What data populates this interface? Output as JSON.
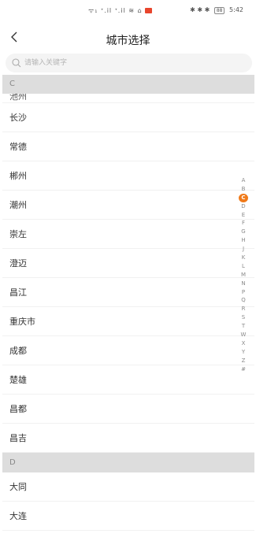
{
  "status_bar": {
    "signal_text": "ᯤ₁ ᐩ.il ᐩ.il ≋ ⌂",
    "right_icons": "✱ ✱ ✱",
    "battery": "88",
    "time": "5:42"
  },
  "nav": {
    "title": "城市选择"
  },
  "search": {
    "placeholder": "请输入关键字",
    "value": ""
  },
  "sections": [
    {
      "letter": "C",
      "partial_city": "池州",
      "cities": [
        "长沙",
        "常德",
        "郴州",
        "潮州",
        "崇左",
        "澄迈",
        "昌江",
        "重庆市",
        "成都",
        "楚雄",
        "昌都",
        "昌吉"
      ]
    },
    {
      "letter": "D",
      "cities": [
        "大同",
        "大连"
      ]
    }
  ],
  "index": {
    "letters": [
      "A",
      "B",
      "C",
      "D",
      "E",
      "F",
      "G",
      "H",
      "J",
      "K",
      "L",
      "M",
      "N",
      "P",
      "Q",
      "R",
      "S",
      "T",
      "W",
      "X",
      "Y",
      "Z",
      "#"
    ],
    "active": "C",
    "active_color": "#f07a1a"
  }
}
